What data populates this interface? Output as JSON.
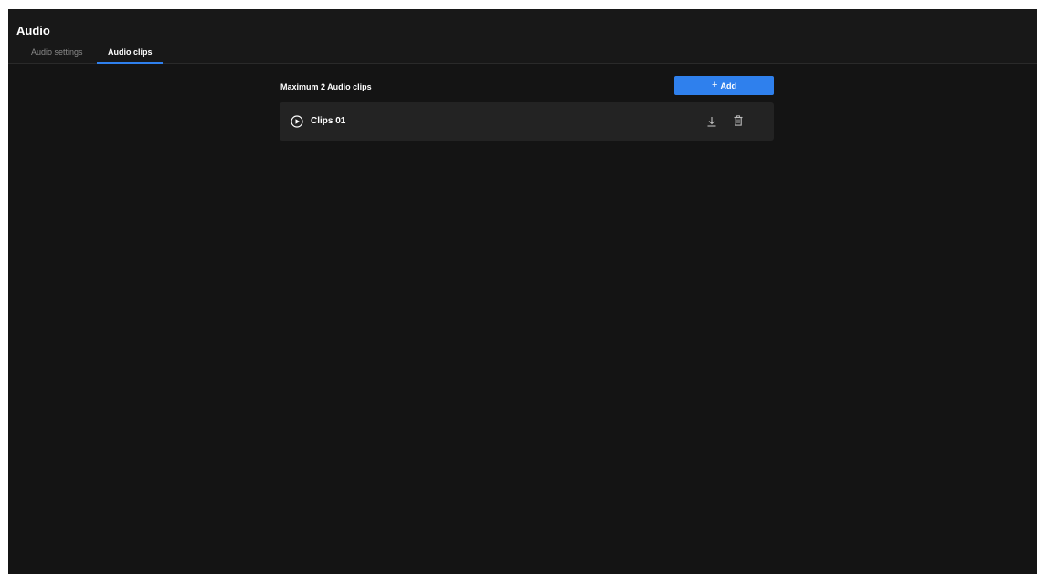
{
  "header": {
    "title": "Audio"
  },
  "tabs": [
    {
      "label": "Audio settings",
      "active": false
    },
    {
      "label": "Audio clips",
      "active": true
    }
  ],
  "clips_section": {
    "limit_label": "Maximum 2 Audio clips",
    "add_button": {
      "icon": "plus-icon",
      "label": "Add"
    },
    "clips": [
      {
        "name": "Clips 01",
        "play_icon": "play-circle-icon",
        "download_icon": "download-icon",
        "delete_icon": "trash-icon"
      }
    ]
  },
  "colors": {
    "background": "#141414",
    "header": "#181818",
    "row": "#232323",
    "accent": "#2f80ed"
  }
}
